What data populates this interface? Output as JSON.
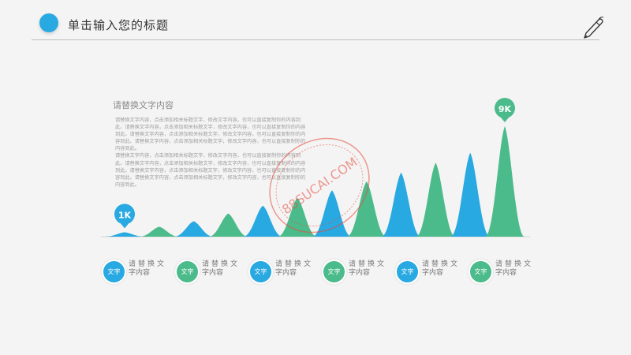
{
  "header": {
    "title": "单击输入您的标题"
  },
  "text_block": {
    "title": "请替换文字内容",
    "paragraph": "请替换文字内容，点击添加相关标题文字，修改文字内容，也可以直接复制你的内容到此。请替换文字内容，点击添加相关标题文字，修改文字内容，也可以直接复制你的内容到此。请替换文字内容，点击添加相关标题文字，修改文字内容，也可以直接复制你的内容到此。请替换文字内容，点击添加相关标题文字，修改文字内容，也可以直接复制你的内容到此。\n请替换文字内容，点击添加相关标题文字，修改文字内容，也可以直接复制你的内容到此。请替换文字内容，点击添加相关标题文字，修改文字内容，也可以直接复制你的内容到此。请替换文字内容，点击添加相关标题文字，修改文字内容，也可以直接复制你的内容到此。请替换文字内容，点击添加相关标题文字，修改文字内容，也可以直接复制你的内容到此。"
  },
  "watermark": {
    "text": "88SUCAI.COM"
  },
  "legend": [
    {
      "badge": "文字",
      "line1": "请替换文",
      "line2": "字内容",
      "color": "#29a9e1"
    },
    {
      "badge": "文字",
      "line1": "请替换文",
      "line2": "字内容",
      "color": "#4cbb8b"
    },
    {
      "badge": "文字",
      "line1": "请替换文",
      "line2": "字内容",
      "color": "#29a9e1"
    },
    {
      "badge": "文字",
      "line1": "请替换文",
      "line2": "字内容",
      "color": "#4cbb8b"
    },
    {
      "badge": "文字",
      "line1": "请替换文",
      "line2": "字内容",
      "color": "#29a9e1"
    },
    {
      "badge": "文字",
      "line1": "请替换文",
      "line2": "字内容",
      "color": "#4cbb8b"
    }
  ],
  "chart_data": {
    "type": "area",
    "colors": [
      "#29a9e1",
      "#4cbb8b"
    ],
    "values": [
      0.04,
      0.09,
      0.14,
      0.21,
      0.28,
      0.35,
      0.42,
      0.5,
      0.58,
      0.67,
      0.76,
      1.0
    ],
    "annotations": [
      {
        "index": 0,
        "label": "1K"
      },
      {
        "index": 11,
        "label": "9K"
      }
    ]
  }
}
